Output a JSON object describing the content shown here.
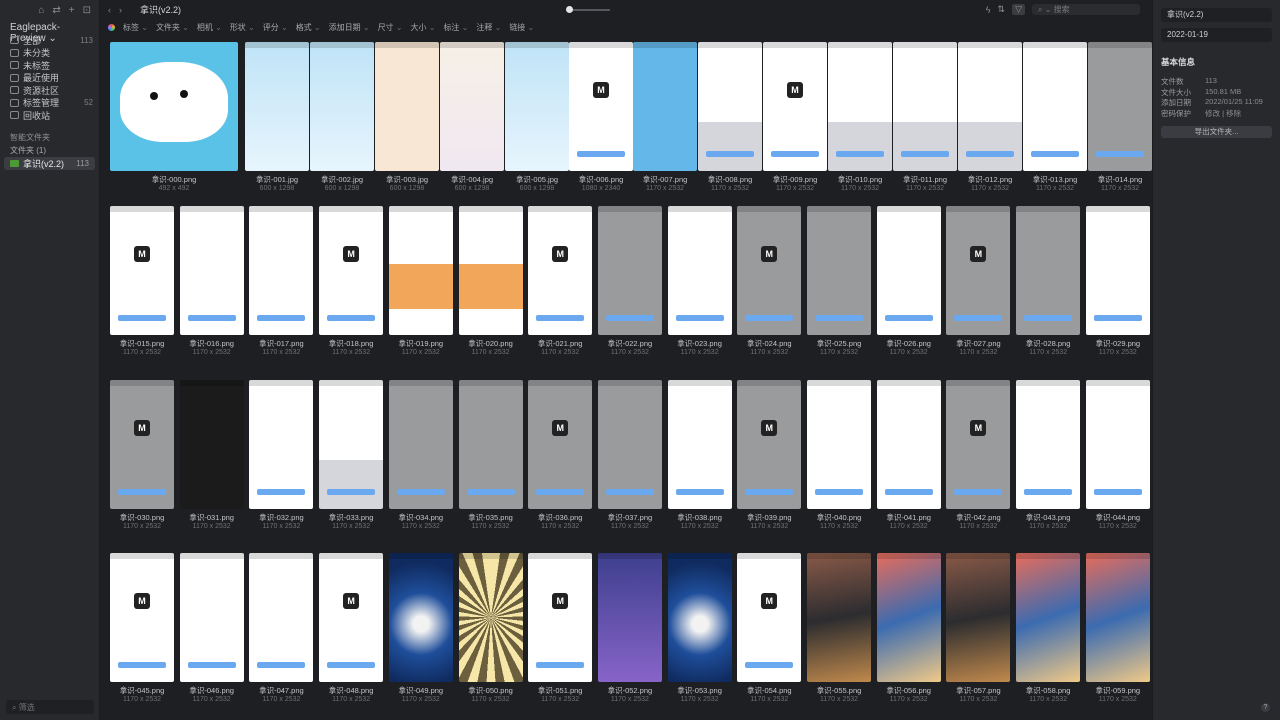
{
  "sidebar": {
    "library": "Eaglepack-Preview",
    "items": [
      {
        "label": "全部",
        "count": "113"
      },
      {
        "label": "未分类",
        "count": ""
      },
      {
        "label": "未标签",
        "count": ""
      },
      {
        "label": "最近使用",
        "count": ""
      },
      {
        "label": "资源社区",
        "count": ""
      },
      {
        "label": "标签管理",
        "count": "52"
      },
      {
        "label": "回收站",
        "count": ""
      }
    ],
    "smart_folders": "智能文件夹",
    "folders": "文件夹 (1)",
    "active_folder": {
      "label": "拿识(v2.2)",
      "count": "113"
    },
    "filter_placeholder": "筛选"
  },
  "toolbar": {
    "title": "拿识(v2.2)",
    "search_placeholder": "搜索"
  },
  "filters": [
    "标签",
    "文件夹",
    "相机",
    "形状",
    "评分",
    "格式",
    "添加日期",
    "尺寸",
    "大小",
    "标注",
    "注释",
    "链接"
  ],
  "files": [
    {
      "name": "拿识-000.png",
      "dim": "492 x 492",
      "style": "t-hero"
    },
    {
      "name": "拿识-001.jpg",
      "dim": "600 x 1298",
      "style": "t-blue"
    },
    {
      "name": "拿识-002.jpg",
      "dim": "600 x 1298",
      "style": "t-blue"
    },
    {
      "name": "拿识-003.jpg",
      "dim": "600 x 1298",
      "style": "t-peach"
    },
    {
      "name": "拿识-004.jpg",
      "dim": "600 x 1298",
      "style": "t-pink"
    },
    {
      "name": "拿识-005.jpg",
      "dim": "600 x 1298",
      "style": "t-blue"
    },
    {
      "name": "拿识-006.png",
      "dim": "1080 x 2340",
      "style": "t-white"
    },
    {
      "name": "拿识-007.png",
      "dim": "1170 x 2532",
      "style": "t-sky"
    },
    {
      "name": "拿识-008.png",
      "dim": "1170 x 2532",
      "style": "t-kbd"
    },
    {
      "name": "拿识-009.png",
      "dim": "1170 x 2532",
      "style": "t-white"
    },
    {
      "name": "拿识-010.png",
      "dim": "1170 x 2532",
      "style": "t-kbd"
    },
    {
      "name": "拿识-011.png",
      "dim": "1170 x 2532",
      "style": "t-kbd"
    },
    {
      "name": "拿识-012.png",
      "dim": "1170 x 2532",
      "style": "t-kbd"
    },
    {
      "name": "拿识-013.png",
      "dim": "1170 x 2532",
      "style": "t-white"
    },
    {
      "name": "拿识-014.png",
      "dim": "1170 x 2532",
      "style": "t-gray"
    },
    {
      "name": "拿识-015.png",
      "dim": "1170 x 2532",
      "style": "t-white"
    },
    {
      "name": "拿识-016.png",
      "dim": "1170 x 2532",
      "style": "t-white"
    },
    {
      "name": "拿识-017.png",
      "dim": "1170 x 2532",
      "style": "t-white"
    },
    {
      "name": "拿识-018.png",
      "dim": "1170 x 2532",
      "style": "t-white"
    },
    {
      "name": "拿识-019.png",
      "dim": "1170 x 2532",
      "style": "t-mix"
    },
    {
      "name": "拿识-020.png",
      "dim": "1170 x 2532",
      "style": "t-mix"
    },
    {
      "name": "拿识-021.png",
      "dim": "1170 x 2532",
      "style": "t-white"
    },
    {
      "name": "拿识-022.png",
      "dim": "1170 x 2532",
      "style": "t-gray"
    },
    {
      "name": "拿识-023.png",
      "dim": "1170 x 2532",
      "style": "t-white"
    },
    {
      "name": "拿识-024.png",
      "dim": "1170 x 2532",
      "style": "t-gray"
    },
    {
      "name": "拿识-025.png",
      "dim": "1170 x 2532",
      "style": "t-gray"
    },
    {
      "name": "拿识-026.png",
      "dim": "1170 x 2532",
      "style": "t-white"
    },
    {
      "name": "拿识-027.png",
      "dim": "1170 x 2532",
      "style": "t-gray"
    },
    {
      "name": "拿识-028.png",
      "dim": "1170 x 2532",
      "style": "t-gray"
    },
    {
      "name": "拿识-029.png",
      "dim": "1170 x 2532",
      "style": "t-white"
    },
    {
      "name": "拿识-030.png",
      "dim": "1170 x 2532",
      "style": "t-gray"
    },
    {
      "name": "拿识-031.png",
      "dim": "1170 x 2532",
      "style": "t-dark"
    },
    {
      "name": "拿识-032.png",
      "dim": "1170 x 2532",
      "style": "t-white"
    },
    {
      "name": "拿识-033.png",
      "dim": "1170 x 2532",
      "style": "t-kbd"
    },
    {
      "name": "拿识-034.png",
      "dim": "1170 x 2532",
      "style": "t-gray"
    },
    {
      "name": "拿识-035.png",
      "dim": "1170 x 2532",
      "style": "t-gray"
    },
    {
      "name": "拿识-036.png",
      "dim": "1170 x 2532",
      "style": "t-gray"
    },
    {
      "name": "拿识-037.png",
      "dim": "1170 x 2532",
      "style": "t-gray"
    },
    {
      "name": "拿识-038.png",
      "dim": "1170 x 2532",
      "style": "t-white"
    },
    {
      "name": "拿识-039.png",
      "dim": "1170 x 2532",
      "style": "t-gray"
    },
    {
      "name": "拿识-040.png",
      "dim": "1170 x 2532",
      "style": "t-white"
    },
    {
      "name": "拿识-041.png",
      "dim": "1170 x 2532",
      "style": "t-white"
    },
    {
      "name": "拿识-042.png",
      "dim": "1170 x 2532",
      "style": "t-gray"
    },
    {
      "name": "拿识-043.png",
      "dim": "1170 x 2532",
      "style": "t-white"
    },
    {
      "name": "拿识-044.png",
      "dim": "1170 x 2532",
      "style": "t-white"
    },
    {
      "name": "拿识-045.png",
      "dim": "1170 x 2532",
      "style": "t-white"
    },
    {
      "name": "拿识-046.png",
      "dim": "1170 x 2532",
      "style": "t-white"
    },
    {
      "name": "拿识-047.png",
      "dim": "1170 x 2532",
      "style": "t-white"
    },
    {
      "name": "拿识-048.png",
      "dim": "1170 x 2532",
      "style": "t-white"
    },
    {
      "name": "拿识-049.png",
      "dim": "1170 x 2532",
      "style": "t-poster"
    },
    {
      "name": "拿识-050.png",
      "dim": "1170 x 2532",
      "style": "t-burst"
    },
    {
      "name": "拿识-051.png",
      "dim": "1170 x 2532",
      "style": "t-white"
    },
    {
      "name": "拿识-052.png",
      "dim": "1170 x 2532",
      "style": "t-violet"
    },
    {
      "name": "拿识-053.png",
      "dim": "1170 x 2532",
      "style": "t-poster"
    },
    {
      "name": "拿识-054.png",
      "dim": "1170 x 2532",
      "style": "t-white"
    },
    {
      "name": "拿识-055.png",
      "dim": "1170 x 2532",
      "style": "t-photo2"
    },
    {
      "name": "拿识-056.png",
      "dim": "1170 x 2532",
      "style": "t-photo"
    },
    {
      "name": "拿识-057.png",
      "dim": "1170 x 2532",
      "style": "t-photo2"
    },
    {
      "name": "拿识-058.png",
      "dim": "1170 x 2532",
      "style": "t-photo"
    },
    {
      "name": "拿识-059.png",
      "dim": "1170 x 2532",
      "style": "t-photo"
    }
  ],
  "inspector": {
    "name": "拿识(v2.2)",
    "date": "2022-01-19",
    "section_title": "基本信息",
    "rows": [
      {
        "k": "文件数",
        "v": "113"
      },
      {
        "k": "文件大小",
        "v": "150.81 MB"
      },
      {
        "k": "添加日期",
        "v": "2022/01/25 11:09"
      },
      {
        "k": "密码保护",
        "v": "修改 | 移除"
      }
    ],
    "export_label": "导出文件夹..."
  }
}
